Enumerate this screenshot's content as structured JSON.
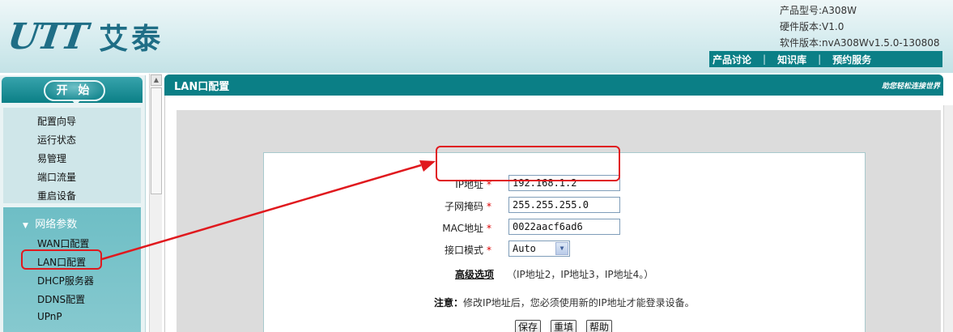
{
  "header": {
    "logo_mark": "UTT",
    "logo_cn": "艾泰",
    "product_model": "产品型号:A308W",
    "hardware_version": "硬件版本:V1.0",
    "software_version": "软件版本:nvA308Wv1.5.0-130808",
    "links": [
      "产品讨论",
      "知识库",
      "预约服务"
    ]
  },
  "sidebar": {
    "start_label": "开 始",
    "top_items": [
      "配置向导",
      "运行状态",
      "易管理",
      "端口流量",
      "重启设备"
    ],
    "group_label": "网络参数",
    "group_items": [
      "WAN口配置",
      "LAN口配置",
      "DHCP服务器",
      "DDNS配置",
      "UPnP"
    ]
  },
  "content": {
    "title": "LAN口配置",
    "slogan": "助您轻松连接世界",
    "fields": {
      "ip_label": "IP地址",
      "ip_value": "192.168.1.2",
      "mask_label": "子网掩码",
      "mask_value": "255.255.255.0",
      "mac_label": "MAC地址",
      "mac_value": "0022aacf6ad6",
      "mode_label": "接口模式",
      "mode_value": "Auto"
    },
    "required_mark": "*",
    "advanced_link": "高级选项",
    "advanced_hint": "（IP地址2，IP地址3，IP地址4。）",
    "note_label": "注意：",
    "note_text": "修改IP地址后，您必须使用新的IP地址才能登录设备。",
    "buttons": {
      "save": "保存",
      "refill": "重填",
      "help": "帮助"
    }
  },
  "colors": {
    "brand": "#0b7f86",
    "logo": "#1f6e86",
    "annotation": "#e0191e"
  }
}
